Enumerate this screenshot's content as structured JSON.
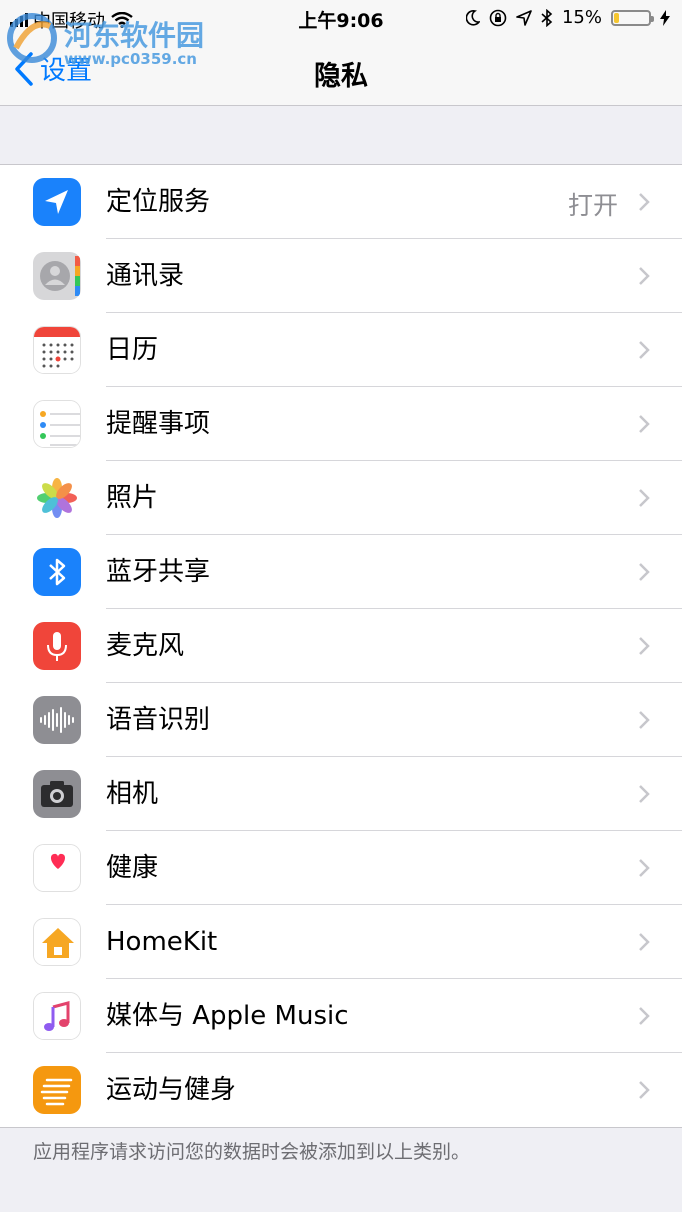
{
  "status_bar": {
    "carrier": "中国移动",
    "time": "上午9:06",
    "battery_percent_label": "15%",
    "battery_level": 0.15
  },
  "watermark": {
    "text": "河东软件园",
    "url": "www.pc0359.cn"
  },
  "nav": {
    "back_label": "设置",
    "title": "隐私"
  },
  "rows": [
    {
      "label": "定位服务",
      "value": "打开",
      "icon": "location-arrow-icon"
    },
    {
      "label": "通讯录",
      "icon": "contacts-icon"
    },
    {
      "label": "日历",
      "icon": "calendar-icon"
    },
    {
      "label": "提醒事项",
      "icon": "reminders-icon"
    },
    {
      "label": "照片",
      "icon": "photos-icon"
    },
    {
      "label": "蓝牙共享",
      "icon": "bluetooth-icon"
    },
    {
      "label": "麦克风",
      "icon": "microphone-icon"
    },
    {
      "label": "语音识别",
      "icon": "speech-recognition-icon"
    },
    {
      "label": "相机",
      "icon": "camera-icon"
    },
    {
      "label": "健康",
      "icon": "health-heart-icon"
    },
    {
      "label": "HomeKit",
      "icon": "homekit-house-icon"
    },
    {
      "label": "媒体与 Apple Music",
      "icon": "music-note-icon"
    },
    {
      "label": "运动与健身",
      "icon": "motion-fitness-icon"
    }
  ],
  "footer": "应用程序请求访问您的数据时会被添加到以上类别。",
  "colors": {
    "accent": "#007aff",
    "background": "#efeff4",
    "battery": "#f5c630"
  }
}
